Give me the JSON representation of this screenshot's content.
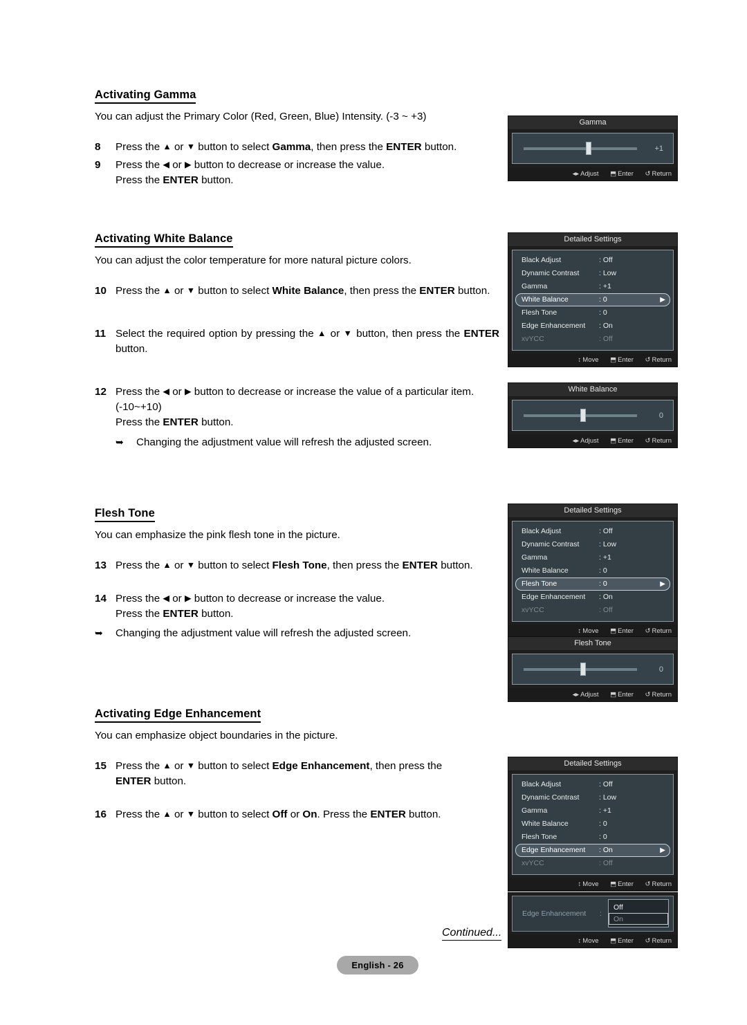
{
  "document": {
    "page_label": "English - 26",
    "continued_label": "Continued..."
  },
  "sections": [
    {
      "heading": "Activating Gamma",
      "intro": "You can adjust the Primary Color (Red, Green, Blue) Intensity. (-3 ~ +3)",
      "steps": [
        {
          "num": "8",
          "text_1": "Press the ",
          "up": "▲",
          "mid_1": " or ",
          "down": "▼",
          "mid_2": " button to select ",
          "bold_1": "Gamma",
          "mid_3": ", then press the ",
          "bold_2": "ENTER",
          "tail": " button."
        },
        {
          "num": "9",
          "text_1": "Press the ",
          "up": "◀",
          "mid_1": " or ",
          "down": "▶",
          "mid_2": " button to decrease or increase the value.",
          "cont_pre": "Press the ",
          "cont_bold": "ENTER",
          "cont_post": " button."
        }
      ]
    },
    {
      "heading": "Activating White Balance",
      "intro": "You can adjust the color temperature for more natural picture colors.",
      "steps": [
        {
          "num": "10",
          "text_1": "Press the ",
          "up": "▲",
          "mid_1": " or ",
          "down": "▼",
          "mid_2": " button to select ",
          "bold_1": "White Balance",
          "mid_3": ", then press the ",
          "bold_2": "ENTER",
          "tail": " button."
        },
        {
          "num": "11",
          "text_1": "Select the required option by pressing the ",
          "up": "▲",
          "mid_1": " or ",
          "down": "▼",
          "mid_2": " button, then press the ",
          "bold_2": "ENTER",
          "tail": " button."
        },
        {
          "num": "12",
          "text_1": "Press the ",
          "up": "◀",
          "mid_1": " or ",
          "down": "▶",
          "mid_2": " button to decrease or increase the value of a particular item.",
          "range": "(-10~+10)",
          "cont_pre": "Press the ",
          "cont_bold": "ENTER",
          "cont_post": " button."
        }
      ],
      "note": "Changing the adjustment value will refresh the adjusted screen."
    },
    {
      "heading": "Flesh Tone",
      "intro": "You can emphasize the pink flesh tone in the picture.",
      "steps": [
        {
          "num": "13",
          "text_1": "Press the ",
          "up": "▲",
          "mid_1": " or ",
          "down": "▼",
          "mid_2": " button to select ",
          "bold_1": "Flesh Tone",
          "mid_3": ", then press the ",
          "bold_2": "ENTER",
          "tail": " button."
        },
        {
          "num": "14",
          "text_1": "Press the ",
          "up": "◀",
          "mid_1": " or ",
          "down": "▶",
          "mid_2": " button to decrease or increase the value.",
          "cont_pre": "Press the ",
          "cont_bold": "ENTER",
          "cont_post": " button."
        }
      ],
      "note": "Changing the adjustment value will refresh the adjusted screen."
    },
    {
      "heading": "Activating Edge Enhancement",
      "intro": "You can emphasize object boundaries in the picture.",
      "steps": [
        {
          "num": "15",
          "text_1": "Press the ",
          "up": "▲",
          "mid_1": " or ",
          "down": "▼",
          "mid_2": " button to select ",
          "bold_1": "Edge Enhancement",
          "mid_3": ", then press the ",
          "cont_bold": "ENTER",
          "cont_post": " button."
        },
        {
          "num": "16",
          "text_1": "Press the ",
          "up": "▲",
          "mid_1": " or ",
          "down": "▼",
          "mid_2": " button to select ",
          "bold_1": "Off",
          "mid_3": " or ",
          "bold_2": "On",
          "tail": ". Press the ",
          "bold_3": "ENTER",
          "tail2": " button."
        }
      ]
    }
  ],
  "osd": {
    "footer_move": "Move",
    "footer_adjust": "Adjust",
    "footer_enter": "Enter",
    "footer_return": "Return",
    "glyph_move": "↕",
    "glyph_adjust": "◂▸",
    "glyph_enter": "⬒",
    "glyph_return": "↺",
    "caret": "▶",
    "panels": [
      {
        "id": "gamma-slider",
        "type": "slider",
        "title": "Gamma",
        "value": "+1",
        "knob_percent": 55
      },
      {
        "id": "detailed-settings-white-balance",
        "type": "list",
        "title": "Detailed Settings",
        "rows": [
          {
            "label": "Black Adjust",
            "value": ": Off",
            "state": "normal"
          },
          {
            "label": "Dynamic Contrast",
            "value": ": Low",
            "state": "normal"
          },
          {
            "label": "Gamma",
            "value": ": +1",
            "state": "normal"
          },
          {
            "label": "White Balance",
            "value": ": 0",
            "state": "selected"
          },
          {
            "label": "Flesh Tone",
            "value": ": 0",
            "state": "normal"
          },
          {
            "label": "Edge Enhancement",
            "value": ": On",
            "state": "normal"
          },
          {
            "label": "xvYCC",
            "value": ": Off",
            "state": "disabled"
          }
        ]
      },
      {
        "id": "white-balance-slider",
        "type": "slider",
        "title": "White Balance",
        "value": "0",
        "knob_percent": 50
      },
      {
        "id": "detailed-settings-flesh-tone",
        "type": "list",
        "title": "Detailed Settings",
        "rows": [
          {
            "label": "Black Adjust",
            "value": ": Off",
            "state": "normal"
          },
          {
            "label": "Dynamic Contrast",
            "value": ": Low",
            "state": "normal"
          },
          {
            "label": "Gamma",
            "value": ": +1",
            "state": "normal"
          },
          {
            "label": "White Balance",
            "value": ": 0",
            "state": "normal"
          },
          {
            "label": "Flesh Tone",
            "value": ": 0",
            "state": "selected"
          },
          {
            "label": "Edge Enhancement",
            "value": ": On",
            "state": "normal"
          },
          {
            "label": "xvYCC",
            "value": ": Off",
            "state": "disabled"
          }
        ]
      },
      {
        "id": "flesh-tone-slider",
        "type": "slider",
        "title": "Flesh Tone",
        "value": "0",
        "knob_percent": 50
      },
      {
        "id": "detailed-settings-edge-enhancement",
        "type": "list",
        "title": "Detailed Settings",
        "rows": [
          {
            "label": "Black Adjust",
            "value": ": Off",
            "state": "normal"
          },
          {
            "label": "Dynamic Contrast",
            "value": ": Low",
            "state": "normal"
          },
          {
            "label": "Gamma",
            "value": ": +1",
            "state": "normal"
          },
          {
            "label": "White Balance",
            "value": ": 0",
            "state": "normal"
          },
          {
            "label": "Flesh Tone",
            "value": ": 0",
            "state": "normal"
          },
          {
            "label": "Edge Enhancement",
            "value": ": On",
            "state": "selected"
          },
          {
            "label": "xvYCC",
            "value": ": Off",
            "state": "disabled"
          }
        ]
      },
      {
        "id": "edge-enhancement-options",
        "type": "options",
        "label": "Edge Enhancement",
        "colon": ":",
        "options": [
          {
            "label": "Off",
            "state": "normal"
          },
          {
            "label": "On",
            "state": "marked"
          }
        ]
      }
    ]
  },
  "colors": {
    "osd_panel_bg": "#1e1e1e",
    "osd_title_bg": "#2c2c2c",
    "osd_slider_bg": "#36424a",
    "osd_list_bg": "#343e45",
    "osd_selected_row": "#4b5862",
    "page_badge_bg": "#a8a8a8"
  }
}
